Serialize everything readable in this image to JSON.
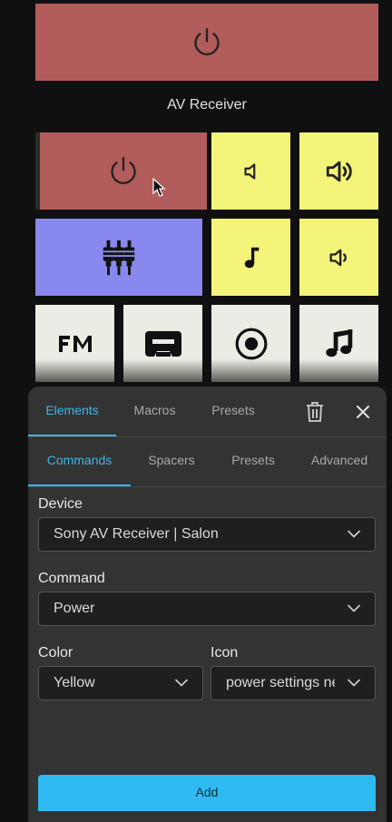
{
  "section": {
    "title": "AV Receiver"
  },
  "tiles": [
    {
      "icon": "power-icon",
      "color": "red"
    },
    {
      "icon": "power-icon",
      "color": "red"
    },
    {
      "icon": "volume-mute-icon",
      "color": "yellow"
    },
    {
      "icon": "volume-up-icon",
      "color": "yellow"
    },
    {
      "icon": "audio-inputs-icon",
      "color": "blue"
    },
    {
      "icon": "music-note-icon",
      "color": "yellow"
    },
    {
      "icon": "volume-down-icon",
      "color": "yellow"
    },
    {
      "icon": "fm-radio-icon",
      "color": "white"
    },
    {
      "icon": "cassette-icon",
      "color": "white"
    },
    {
      "icon": "disc-icon",
      "color": "white"
    },
    {
      "icon": "music-notes-icon",
      "color": "white"
    }
  ],
  "editor": {
    "tabs": [
      "Elements",
      "Macros",
      "Presets"
    ],
    "active_tab": "Elements",
    "subtabs": [
      "Commands",
      "Spacers",
      "Presets",
      "Advanced"
    ],
    "active_subtab": "Commands",
    "device": {
      "label": "Device",
      "value": "Sony AV Receiver | Salon"
    },
    "command": {
      "label": "Command",
      "value": "Power"
    },
    "color": {
      "label": "Color",
      "value": "Yellow"
    },
    "icon": {
      "label": "Icon",
      "value": "power settings new"
    },
    "add_label": "Add"
  },
  "colors": {
    "accent": "#3db5ea",
    "red": "#b25c5c",
    "yellow": "#f4f47a",
    "blue": "#8888ee",
    "white": "#ecebe4",
    "panel": "#333333"
  }
}
